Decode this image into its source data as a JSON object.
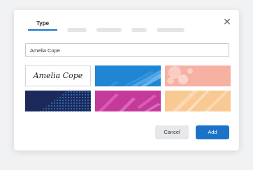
{
  "tabs": {
    "active_label": "Type"
  },
  "input": {
    "value": "Amelia Cope"
  },
  "signature_preview": {
    "text": "Amelia Cope"
  },
  "backgrounds": [
    {
      "name": "blue-brush",
      "color": "#1f86d4"
    },
    {
      "name": "pink-splash",
      "color": "#f6b1a2"
    },
    {
      "name": "navy-dots",
      "color": "#1b2a5a"
    },
    {
      "name": "magenta-brush",
      "color": "#c43a9b"
    },
    {
      "name": "orange-brush",
      "color": "#f8c993"
    }
  ],
  "actions": {
    "cancel_label": "Cancel",
    "add_label": "Add"
  },
  "colors": {
    "accent": "#1a73c8"
  }
}
